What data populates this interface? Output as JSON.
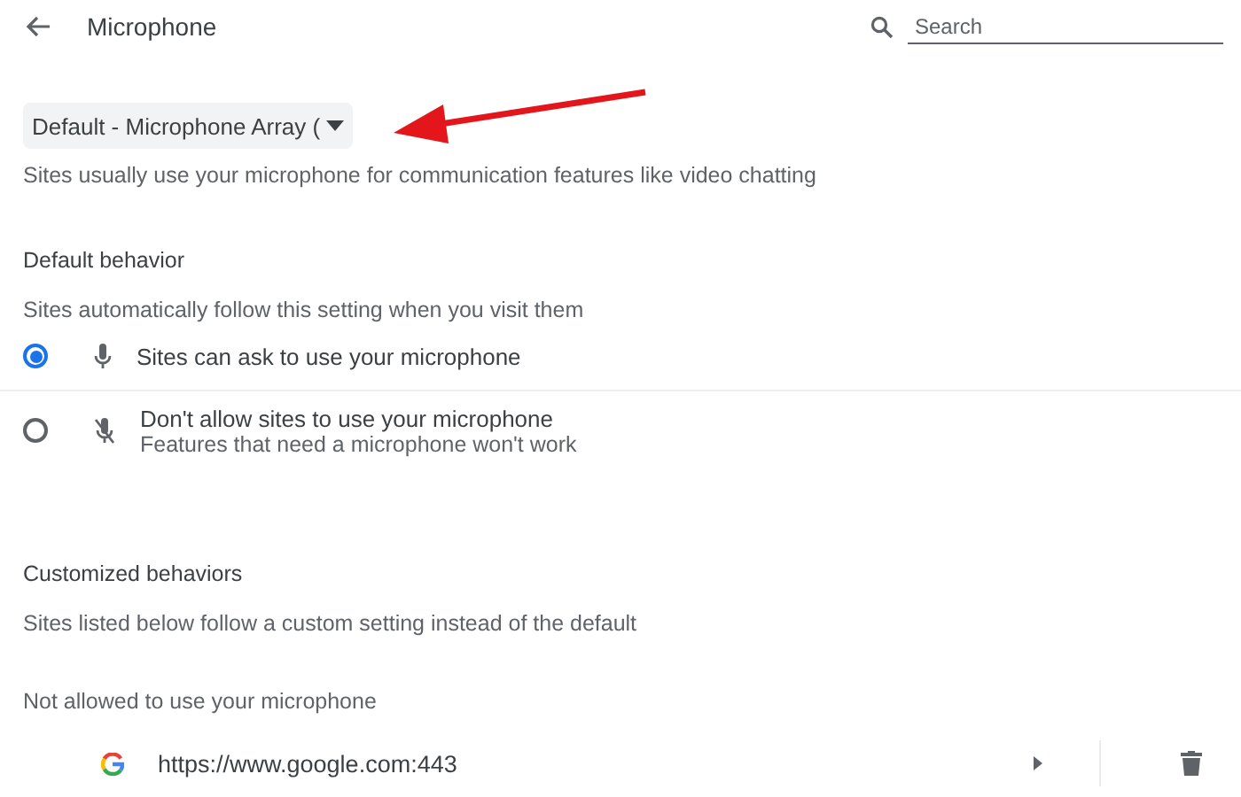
{
  "header": {
    "title": "Microphone",
    "search": {
      "placeholder": "Search"
    }
  },
  "device_select": {
    "value": "Default - Microphone Array ("
  },
  "description": "Sites usually use your microphone for communication features like video chatting",
  "default_behavior": {
    "heading": "Default behavior",
    "subtitle": "Sites automatically follow this setting when you visit them",
    "options": [
      {
        "kind": "mic",
        "label": "Sites can ask to use your microphone",
        "selected": true
      },
      {
        "kind": "mic-off",
        "label": "Don't allow sites to use your microphone",
        "sublabel": "Features that need a microphone won't work",
        "selected": false
      }
    ]
  },
  "customized": {
    "heading": "Customized behaviors",
    "subtitle": "Sites listed below follow a custom setting instead of the default"
  },
  "blocked": {
    "heading": "Not allowed to use your microphone",
    "sites": [
      {
        "url": "https://www.google.com:443"
      }
    ]
  }
}
